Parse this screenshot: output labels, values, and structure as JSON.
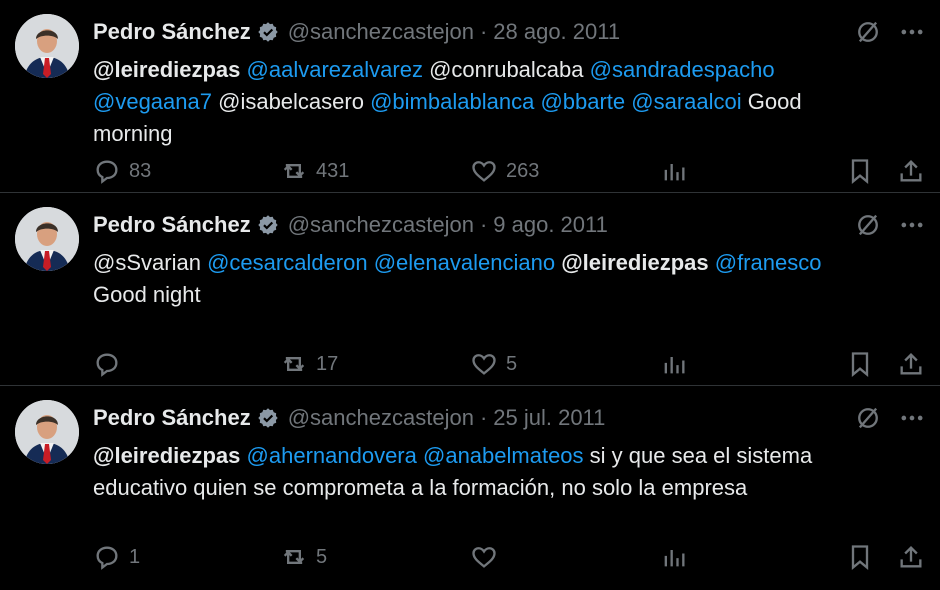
{
  "colors": {
    "background": "#000000",
    "text": "#e7e9ea",
    "muted": "#71767b",
    "accent": "#1d9bf0",
    "divider": "#2f3336"
  },
  "icons": {
    "verified": "verified-badge-icon",
    "grok": "grok-icon",
    "more": "more-icon",
    "reply": "reply-icon",
    "retweet": "retweet-icon",
    "like": "heart-icon",
    "views": "views-icon",
    "bookmark": "bookmark-icon",
    "share": "share-icon"
  },
  "tweets": [
    {
      "author": {
        "name": "Pedro Sánchez",
        "handle": "@sanchezcastejon",
        "separator": "·",
        "date": "28 ago. 2011"
      },
      "text": [
        [
          {
            "text": "@leirediezpas",
            "kind": "strong"
          },
          {
            "text": "@aalvarezalvarez",
            "kind": "mention"
          },
          {
            "text": "@conrubalcaba",
            "kind": "plain"
          },
          {
            "text": "@sandradespacho",
            "kind": "mention"
          }
        ],
        [
          {
            "text": "@vegaana7",
            "kind": "mention"
          },
          {
            "text": "@isabelcasero",
            "kind": "plain"
          },
          {
            "text": "@bimbalablanca",
            "kind": "mention"
          },
          {
            "text": "@bbarte",
            "kind": "mention"
          },
          {
            "text": "@saraalcoi",
            "kind": "mention"
          },
          {
            "text": "Good",
            "kind": "plain"
          }
        ],
        [
          {
            "text": "morning",
            "kind": "plain"
          }
        ]
      ],
      "actions": {
        "reply": "83",
        "retweet": "431",
        "like": "263"
      }
    },
    {
      "author": {
        "name": "Pedro Sánchez",
        "handle": "@sanchezcastejon",
        "separator": "·",
        "date": "9 ago. 2011"
      },
      "text": [
        [
          {
            "text": "@sSvarian",
            "kind": "plain"
          },
          {
            "text": "@cesarcalderon",
            "kind": "mention"
          },
          {
            "text": "@elenavalenciano",
            "kind": "mention"
          },
          {
            "text": "@leirediezpas",
            "kind": "strong"
          },
          {
            "text": "@franesco",
            "kind": "mention"
          }
        ],
        [
          {
            "text": "Good night",
            "kind": "plain"
          }
        ]
      ],
      "actions": {
        "reply": "",
        "retweet": "17",
        "like": "5"
      }
    },
    {
      "author": {
        "name": "Pedro Sánchez",
        "handle": "@sanchezcastejon",
        "separator": "·",
        "date": "25 jul. 2011"
      },
      "text": [
        [
          {
            "text": "@leirediezpas",
            "kind": "strong"
          },
          {
            "text": "@ahernandovera",
            "kind": "mention"
          },
          {
            "text": "@anabelmateos",
            "kind": "mention"
          },
          {
            "text": "si y que sea el sistema",
            "kind": "plain"
          }
        ],
        [
          {
            "text": "educativo quien se comprometa a la formación, no solo la empresa",
            "kind": "plain"
          }
        ]
      ],
      "actions": {
        "reply": "1",
        "retweet": "5",
        "like": ""
      }
    }
  ]
}
